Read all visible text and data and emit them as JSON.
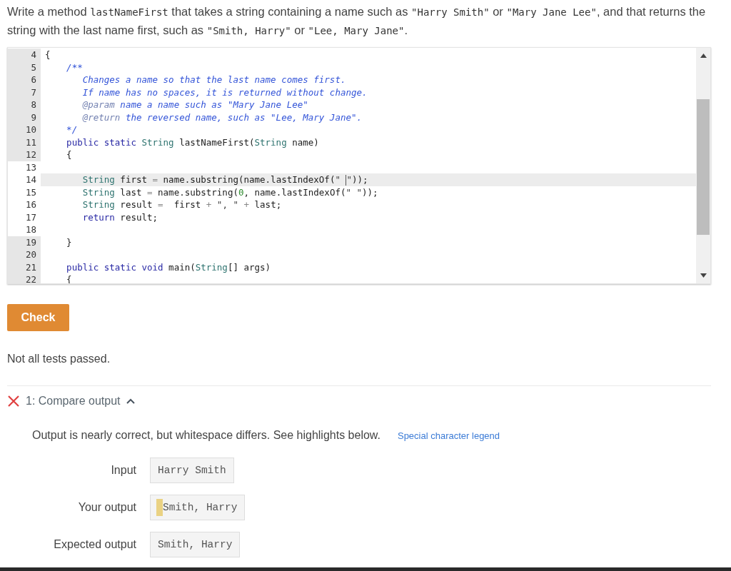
{
  "prompt": [
    {
      "kind": "text",
      "text": "Write a method "
    },
    {
      "kind": "code",
      "text": "lastNameFirst"
    },
    {
      "kind": "text",
      "text": " that takes a string containing a name such as "
    },
    {
      "kind": "code",
      "text": "\"Harry Smith\""
    },
    {
      "kind": "text",
      "text": " or "
    },
    {
      "kind": "code",
      "text": "\"Mary Jane Lee\""
    },
    {
      "kind": "text",
      "text": ", and that returns the string with the last name first, such as "
    },
    {
      "kind": "code",
      "text": "\"Smith, Harry\""
    },
    {
      "kind": "text",
      "text": " or "
    },
    {
      "kind": "code",
      "text": "\"Lee, Mary Jane\""
    },
    {
      "kind": "text",
      "text": "."
    }
  ],
  "editor": {
    "lines": [
      {
        "number": "4",
        "editable": false,
        "selected": false,
        "tokens": [
          {
            "kind": "plain",
            "text": "{"
          }
        ]
      },
      {
        "number": "5",
        "editable": false,
        "selected": false,
        "tokens": [
          {
            "kind": "comment",
            "text": "    /**"
          }
        ]
      },
      {
        "number": "6",
        "editable": false,
        "selected": false,
        "tokens": [
          {
            "kind": "comment",
            "text": "       Changes a name so that the last name comes first."
          }
        ]
      },
      {
        "number": "7",
        "editable": false,
        "selected": false,
        "tokens": [
          {
            "kind": "comment",
            "text": "       If name has no spaces, it is returned without change."
          }
        ]
      },
      {
        "number": "8",
        "editable": false,
        "selected": false,
        "tokens": [
          {
            "kind": "doctag",
            "text": "       @param"
          },
          {
            "kind": "comment",
            "text": " name a name such as \"Mary Jane Lee\""
          }
        ]
      },
      {
        "number": "9",
        "editable": false,
        "selected": false,
        "tokens": [
          {
            "kind": "doctag",
            "text": "       @return"
          },
          {
            "kind": "comment",
            "text": " the reversed name, such as \"Lee, Mary Jane\"."
          }
        ]
      },
      {
        "number": "10",
        "editable": false,
        "selected": false,
        "tokens": [
          {
            "kind": "comment",
            "text": "    */"
          }
        ]
      },
      {
        "number": "11",
        "editable": false,
        "selected": false,
        "tokens": [
          {
            "kind": "keyword",
            "text": "    public static"
          },
          {
            "kind": "type",
            "text": " String"
          },
          {
            "kind": "plain",
            "text": " lastNameFirst("
          },
          {
            "kind": "type",
            "text": "String"
          },
          {
            "kind": "plain",
            "text": " name)"
          }
        ]
      },
      {
        "number": "12",
        "editable": false,
        "selected": false,
        "tokens": [
          {
            "kind": "plain",
            "text": "    {"
          }
        ]
      },
      {
        "number": "13",
        "editable": true,
        "selected": false
      },
      {
        "number": "14",
        "editable": true,
        "selected": true,
        "tokens": [
          {
            "kind": "type",
            "text": "       String"
          },
          {
            "kind": "plain",
            "text": " first "
          },
          {
            "kind": "op",
            "text": "="
          },
          {
            "kind": "plain",
            "text": " name.substring(name.lastIndexOf("
          },
          {
            "kind": "string",
            "text": "\" "
          },
          {
            "kind": "caret"
          },
          {
            "kind": "string",
            "text": "\""
          },
          {
            "kind": "plain",
            "text": "));"
          }
        ]
      },
      {
        "number": "15",
        "editable": true,
        "selected": false,
        "tokens": [
          {
            "kind": "type",
            "text": "       String"
          },
          {
            "kind": "plain",
            "text": " last "
          },
          {
            "kind": "op",
            "text": "="
          },
          {
            "kind": "plain",
            "text": " name.substring("
          },
          {
            "kind": "number",
            "text": "0"
          },
          {
            "kind": "plain",
            "text": ", name.lastIndexOf("
          },
          {
            "kind": "string",
            "text": "\" \""
          },
          {
            "kind": "plain",
            "text": "));"
          }
        ]
      },
      {
        "number": "16",
        "editable": true,
        "selected": false,
        "tokens": [
          {
            "kind": "type",
            "text": "       String"
          },
          {
            "kind": "plain",
            "text": " result "
          },
          {
            "kind": "op",
            "text": "="
          },
          {
            "kind": "plain",
            "text": "  first "
          },
          {
            "kind": "op",
            "text": "+"
          },
          {
            "kind": "string",
            "text": " \", \""
          },
          {
            "kind": "op",
            "text": " +"
          },
          {
            "kind": "plain",
            "text": " last;"
          }
        ]
      },
      {
        "number": "17",
        "editable": true,
        "selected": false,
        "tokens": [
          {
            "kind": "keyword",
            "text": "       return"
          },
          {
            "kind": "plain",
            "text": " result;"
          }
        ]
      },
      {
        "number": "18",
        "editable": true,
        "selected": false
      },
      {
        "number": "19",
        "editable": false,
        "selected": false,
        "tokens": [
          {
            "kind": "plain",
            "text": "    }"
          }
        ]
      },
      {
        "number": "20",
        "editable": false,
        "selected": false
      },
      {
        "number": "21",
        "editable": false,
        "selected": false,
        "tokens": [
          {
            "kind": "keyword",
            "text": "    public static void"
          },
          {
            "kind": "plain",
            "text": " main("
          },
          {
            "kind": "type",
            "text": "String"
          },
          {
            "kind": "plain",
            "text": "[] args)"
          }
        ]
      },
      {
        "number": "22",
        "editable": false,
        "selected": false,
        "tokens": [
          {
            "kind": "plain",
            "text": "    {"
          }
        ]
      }
    ]
  },
  "check_button": "Check",
  "status": "Not all tests passed.",
  "test": {
    "passed": false,
    "expanded": true,
    "title": "1: Compare output",
    "message": "Output is nearly correct, but whitespace differs. See highlights below.",
    "legend_link": "Special character legend",
    "rows": [
      {
        "label": "Input",
        "value": "Harry Smith",
        "leading_space_highlighted": false
      },
      {
        "label": "Your output",
        "value": "Smith, Harry",
        "leading_space_highlighted": true
      },
      {
        "label": "Expected output",
        "value": "Smith, Harry",
        "leading_space_highlighted": false
      }
    ]
  }
}
